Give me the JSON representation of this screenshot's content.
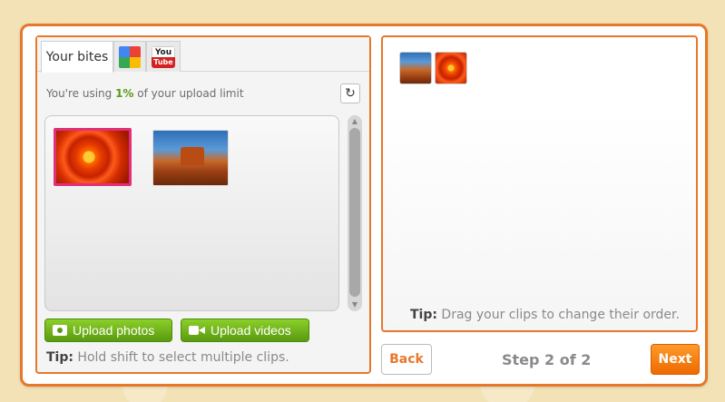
{
  "tabs": [
    {
      "label": "Your bites",
      "active": true
    },
    {
      "icon": "google-icon"
    },
    {
      "icon": "youtube-icon",
      "text_top": "You",
      "text_bottom": "Tube"
    }
  ],
  "usage": {
    "prefix": "You're using ",
    "percent": "1%",
    "suffix": " of your upload limit"
  },
  "refresh_icon": "refresh-icon",
  "refresh_glyph": "↻",
  "scroll": {
    "up": "▲",
    "down": "▼"
  },
  "clips": [
    {
      "name": "flower",
      "selected": true
    },
    {
      "name": "desert",
      "selected": false
    }
  ],
  "buttons": {
    "upload_photos": "Upload photos",
    "upload_videos": "Upload videos",
    "back": "Back",
    "next": "Next"
  },
  "tip_left": {
    "label": "Tip:",
    "text": " Hold shift to select multiple clips."
  },
  "tip_right": {
    "label": "Tip:",
    "text": " Drag your clips to change their order."
  },
  "step": "Step 2 of 2",
  "colors": {
    "accent": "#e8772a",
    "green": "#6aae1a",
    "selected_border": "#e0307a"
  }
}
